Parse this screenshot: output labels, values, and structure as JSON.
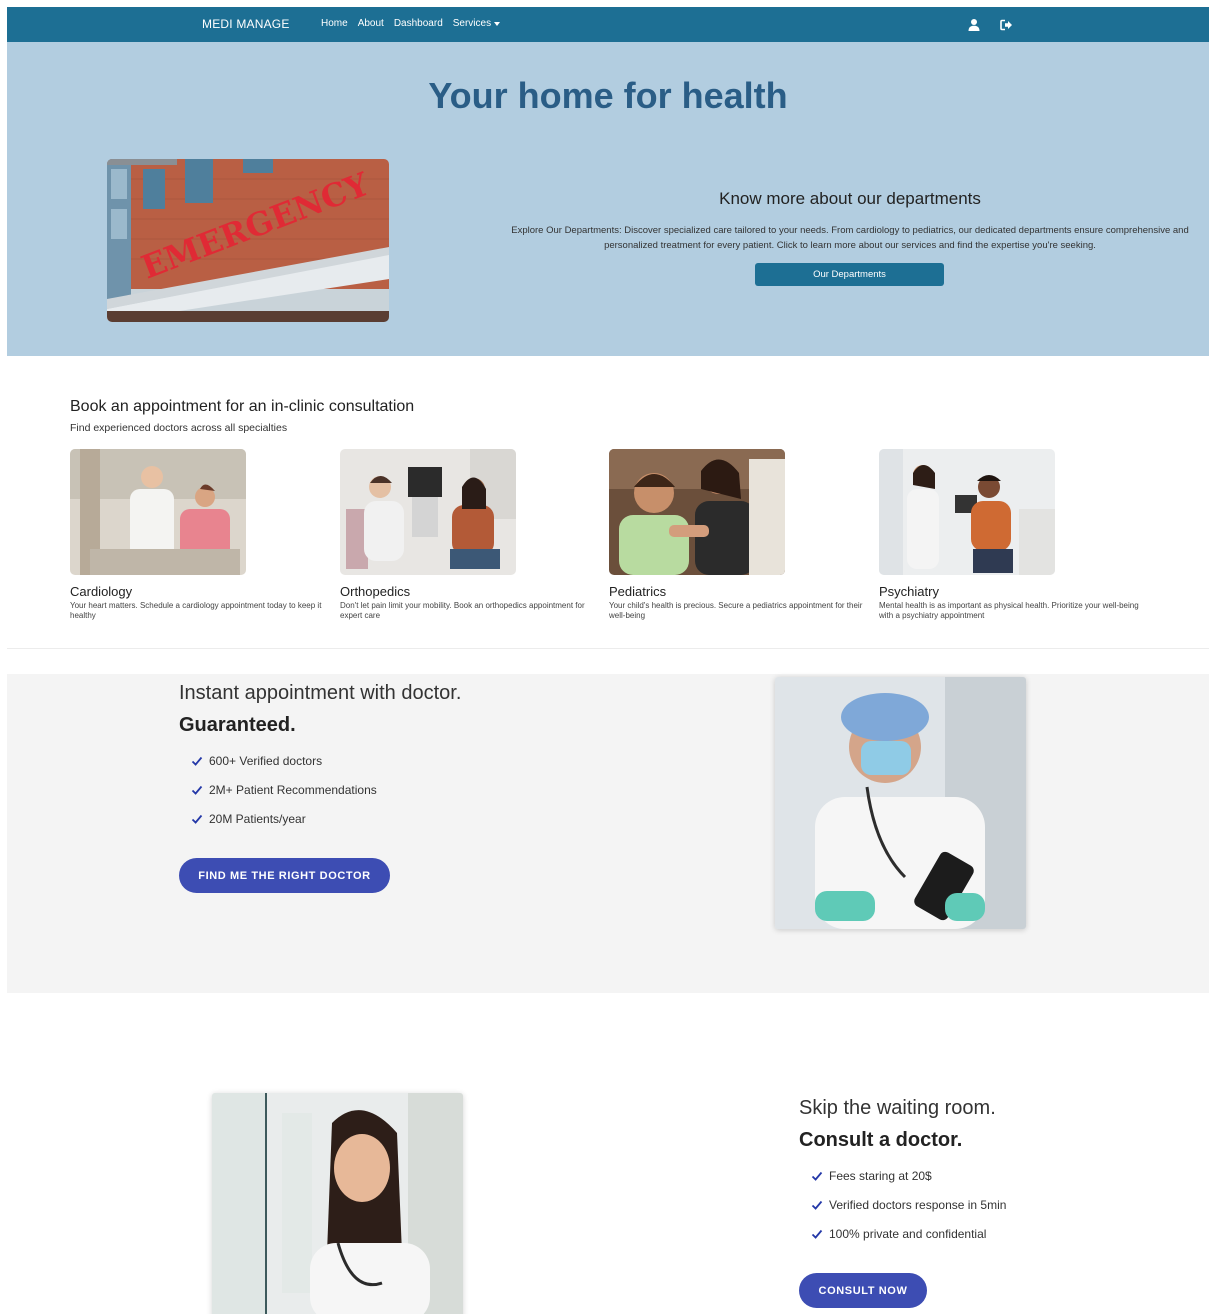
{
  "nav": {
    "brand": "MEDI MANAGE",
    "links": [
      "Home",
      "About",
      "Dashboard"
    ],
    "services": "Services",
    "icons": [
      "user-icon",
      "sign-out-icon"
    ]
  },
  "hero": {
    "title": "Your home for health",
    "image_sign": "EMERGENCY",
    "departments_title": "Know more about our departments",
    "departments_text": "Explore Our Departments: Discover specialized care tailored to your needs. From cardiology to pediatrics, our dedicated departments ensure comprehensive and personalized treatment for every patient. Click to learn more about our services and find the expertise you're seeking.",
    "departments_button": "Our Departments"
  },
  "appointment": {
    "title": "Book an appointment for an in-clinic consultation",
    "subtitle": "Find experienced doctors across all specialties",
    "cards": [
      {
        "name": "Cardiology",
        "desc": "Your heart matters. Schedule a cardiology appointment today to keep it healthy"
      },
      {
        "name": "Orthopedics",
        "desc": "Don't let pain limit your mobility. Book an orthopedics appointment for expert care"
      },
      {
        "name": "Pediatrics",
        "desc": "Your child's health is precious. Secure a pediatrics appointment for their well-being"
      },
      {
        "name": "Psychiatry",
        "desc": "Mental health is as important as physical health. Prioritize your well-being with a psychiatry appointment"
      }
    ]
  },
  "instant": {
    "line1": "Instant appointment with doctor.",
    "line2": "Guaranteed.",
    "features": [
      "600+ Verified doctors",
      "2M+ Patient Recommendations",
      "20M Patients/year"
    ],
    "button": "FIND ME THE RIGHT DOCTOR"
  },
  "skip": {
    "line1": "Skip the waiting room.",
    "line2": "Consult a doctor.",
    "features": [
      "Fees staring at 20$",
      "Verified doctors response in 5min",
      "100% private and confidential"
    ],
    "button": "CONSULT NOW"
  },
  "colors": {
    "navbar": "#1d6f94",
    "hero_bg": "#b2cde0",
    "hero_title": "#2a5d86",
    "accent_button": "#3d4db3",
    "section_bg": "#f4f4f4"
  }
}
